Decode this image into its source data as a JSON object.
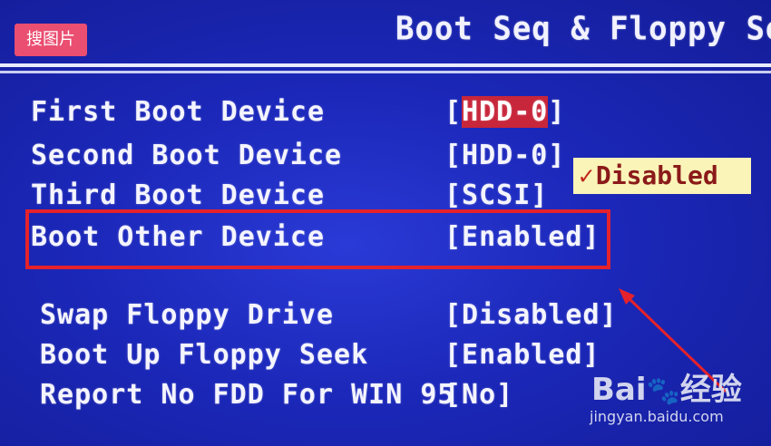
{
  "header": {
    "title": "Boot Seq & Floppy Setu"
  },
  "watermark": {
    "label": "搜图片"
  },
  "settings": [
    {
      "label": "First Boot Device",
      "value_open": "[",
      "value_highlight": "HDD-0",
      "value_close": "]"
    },
    {
      "label": "Second Boot Device",
      "value": "[HDD-0]"
    },
    {
      "label": "Third Boot Device",
      "value": "[SCSI]"
    },
    {
      "label": "Boot Other Device",
      "value": "[Enabled]"
    },
    {
      "label": "Swap Floppy Drive",
      "value": "[Disabled]"
    },
    {
      "label": "Boot Up Floppy Seek",
      "value": "[Enabled]"
    },
    {
      "label": "Report No FDD For WIN 95",
      "value": "[No]"
    }
  ],
  "popup": {
    "check": "✓",
    "option": "Disabled"
  },
  "brand": {
    "name": "Bai",
    "paw": "🐾",
    "suffix": "经验",
    "site": "jingyan.baidu.com"
  },
  "colors": {
    "bios_blue": "#1b27b8",
    "text": "#f4f4ff",
    "highlight": "#c8263a",
    "annotation_red": "#e5222b",
    "popup_bg": "#fbf4b8",
    "watermark_pink": "#ea4e70"
  }
}
